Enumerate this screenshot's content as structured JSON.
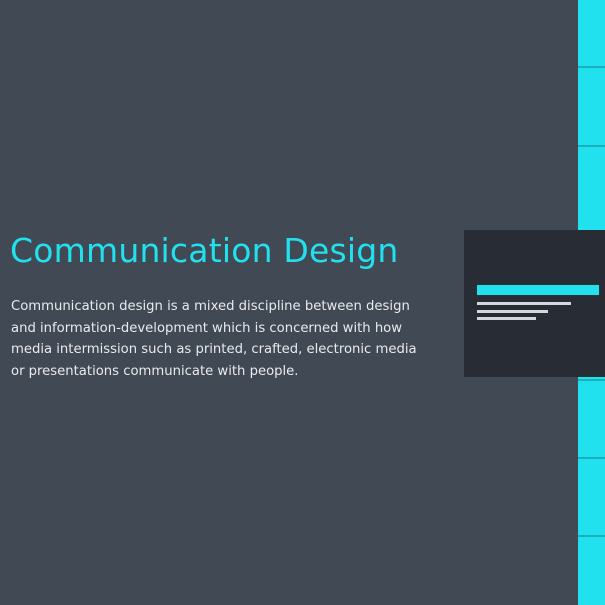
{
  "colors": {
    "background": "#414955",
    "accent": "#22e1ee",
    "accent_separator": "#1bb0bd",
    "card_background": "#282c34",
    "body_text": "#e8eaee",
    "card_line": "#d4d7dc"
  },
  "section": {
    "title": "Communication Design",
    "body": "Communication design is a mixed discipline between design and information-development which is concerned with how media intermission such as printed, crafted, electronic media or presentations communicate with people."
  },
  "card": {
    "icon": "document-lines-icon",
    "line_fractions": [
      1,
      0.76,
      0.63
    ]
  }
}
